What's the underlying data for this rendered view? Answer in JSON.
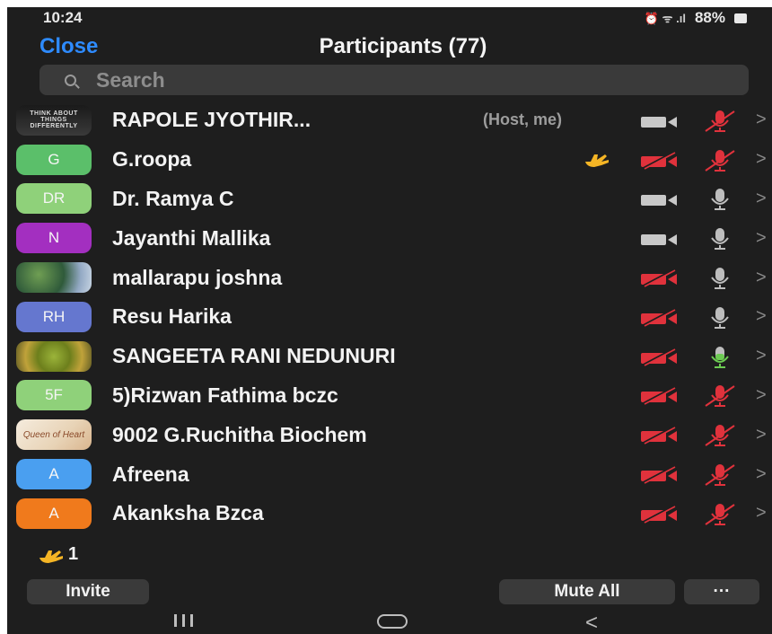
{
  "status_bar": {
    "time": "10:24",
    "icons": "⏰ ᯤ .ıl",
    "battery": "88%"
  },
  "header": {
    "close_label": "Close",
    "title": "Participants (77)"
  },
  "search": {
    "placeholder": "Search"
  },
  "avatar_text_row0": "THINK ABOUT THINGS DIFFERENTLY",
  "avatar_text_row8": "Queen of Heart",
  "participants": [
    {
      "name": "RAPOLE JYOTHIR...",
      "tag": "(Host, me)",
      "avatar": "image",
      "video": "on",
      "audio": "muted"
    },
    {
      "name": "G.roopa",
      "avatar_initials": "G",
      "avatar_color": "#5bbf6a",
      "hand_raised": true,
      "video": "off",
      "audio": "muted"
    },
    {
      "name": "Dr. Ramya C",
      "avatar_initials": "DR",
      "avatar_color": "#8fd17a",
      "video": "on",
      "audio": "unmuted"
    },
    {
      "name": "Jayanthi Mallika",
      "avatar_initials": "N",
      "avatar_color": "#a32fc0",
      "video": "on",
      "audio": "unmuted"
    },
    {
      "name": "mallarapu joshna",
      "avatar": "image",
      "video": "off",
      "audio": "unmuted"
    },
    {
      "name": "Resu Harika",
      "avatar_initials": "RH",
      "avatar_color": "#6577cf",
      "video": "off",
      "audio": "unmuted"
    },
    {
      "name": "SANGEETA RANI NEDUNURI",
      "avatar": "image",
      "video": "off",
      "audio": "speaking"
    },
    {
      "name": "5)Rizwan Fathima bczc",
      "avatar_initials": "5F",
      "avatar_color": "#8fd17a",
      "video": "off",
      "audio": "muted"
    },
    {
      "name": "9002 G.Ruchitha Biochem",
      "avatar": "image",
      "video": "off",
      "audio": "muted"
    },
    {
      "name": "Afreena",
      "avatar_initials": "A",
      "avatar_color": "#4a9ff0",
      "video": "off",
      "audio": "muted"
    },
    {
      "name": "Akanksha Bzca",
      "avatar_initials": "A",
      "avatar_color": "#f07a1c",
      "video": "off",
      "audio": "muted"
    }
  ],
  "footer": {
    "raised_hands_count": "1",
    "invite_label": "Invite",
    "mute_all_label": "Mute All",
    "more_label": "···"
  },
  "colors": {
    "accent": "#2e8bff",
    "muted_red": "#e0323c",
    "camera_on": "#c8c8c8",
    "mic_on": "#bdbdbd",
    "mic_speaking": "#6ccb52",
    "hand": "#f5b525"
  }
}
